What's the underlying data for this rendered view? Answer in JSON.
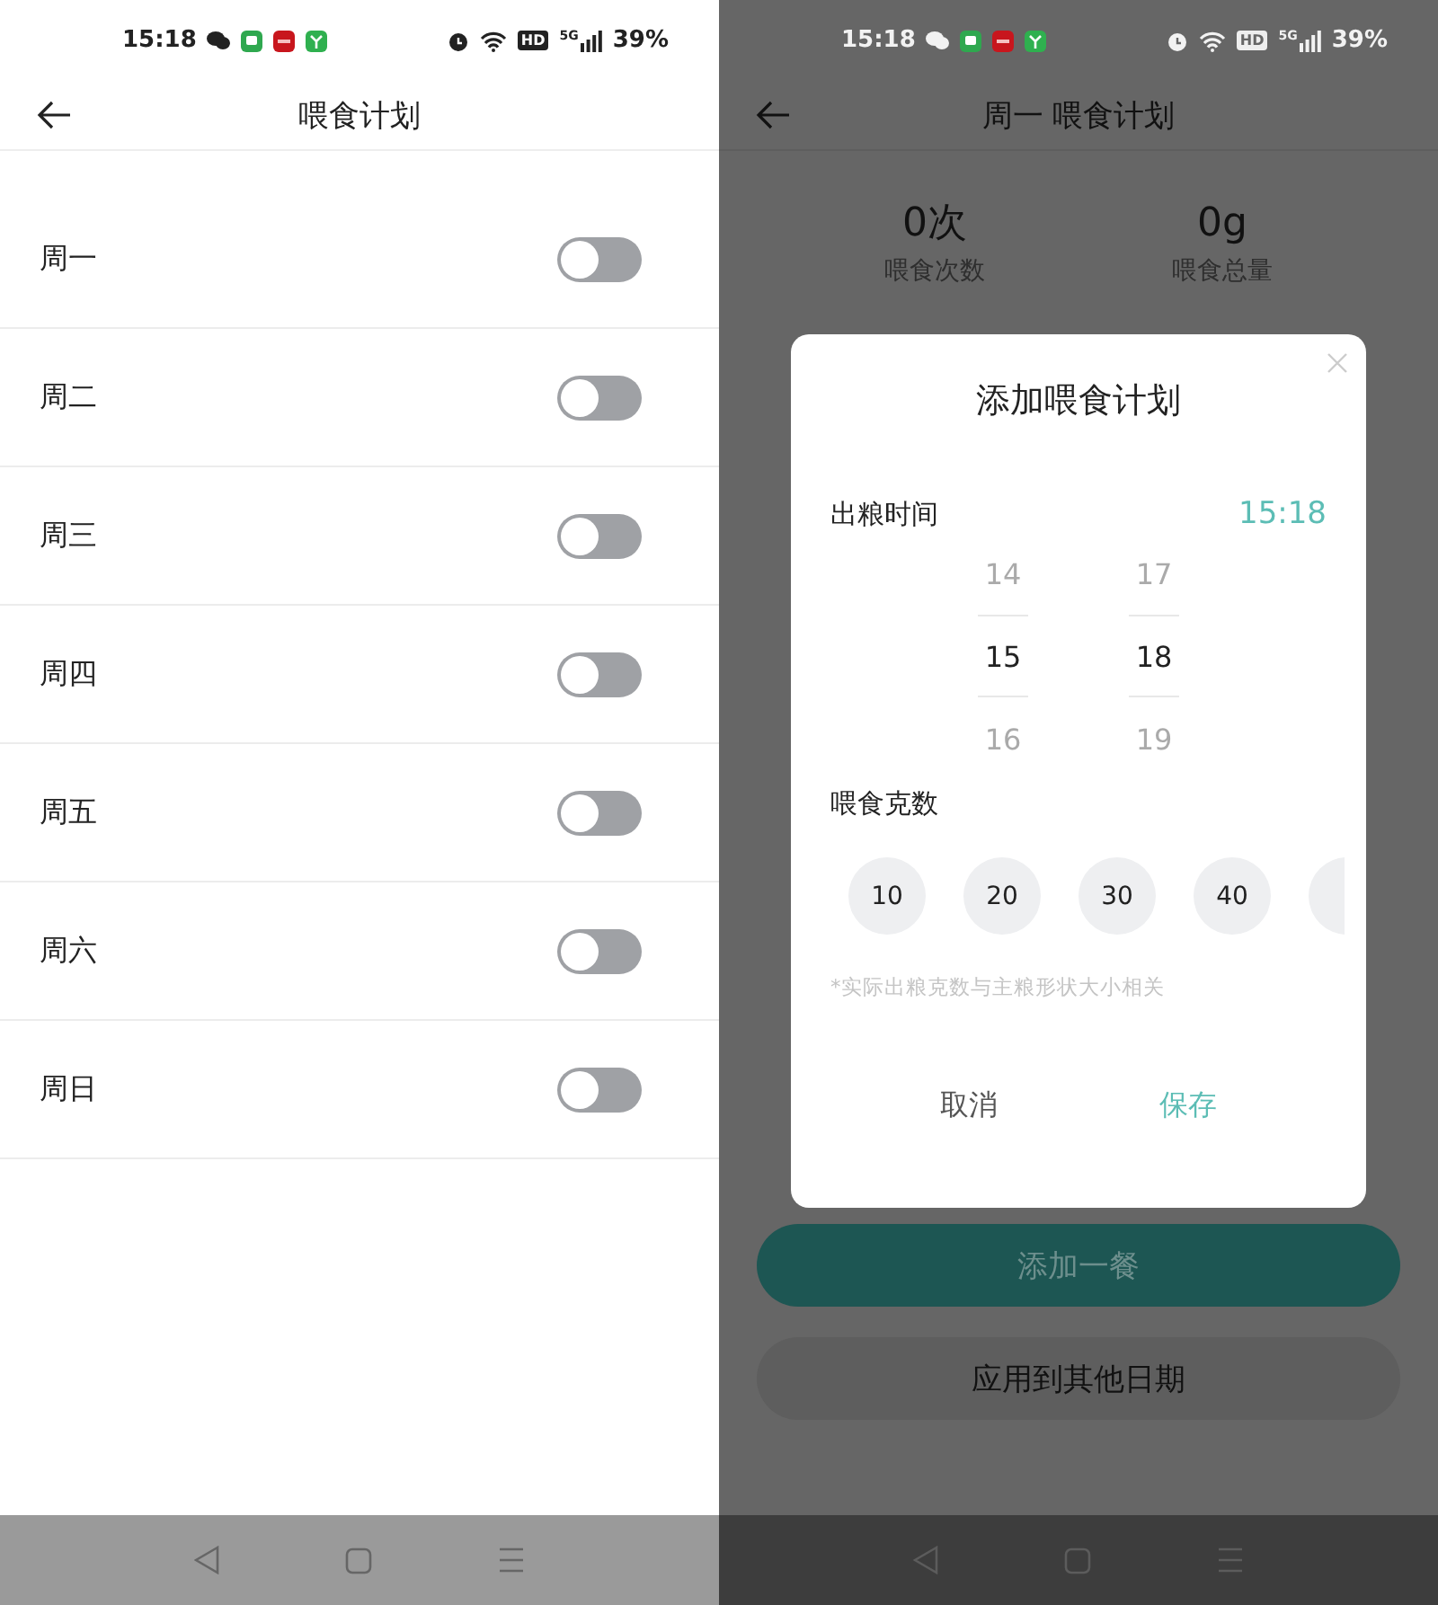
{
  "left_screen": {
    "status_bar": {
      "time": "15:18",
      "hd": "HD",
      "network": "5G",
      "battery": "39%"
    },
    "header": {
      "title": "喂食计划"
    },
    "days": [
      {
        "label": "周一",
        "on": false
      },
      {
        "label": "周二",
        "on": false
      },
      {
        "label": "周三",
        "on": false
      },
      {
        "label": "周四",
        "on": false
      },
      {
        "label": "周五",
        "on": false
      },
      {
        "label": "周六",
        "on": false
      },
      {
        "label": "周日",
        "on": false
      }
    ]
  },
  "right_screen": {
    "status_bar": {
      "time": "15:18",
      "hd": "HD",
      "network": "5G",
      "battery": "39%"
    },
    "header": {
      "title": "周一 喂食计划"
    },
    "stats": [
      {
        "value": "0次",
        "label": "喂食次数"
      },
      {
        "value": "0g",
        "label": "喂食总量"
      }
    ],
    "buttons": [
      {
        "label": "添加一餐",
        "kind": "primary"
      },
      {
        "label": "应用到其他日期",
        "kind": "secondary"
      }
    ],
    "dialog": {
      "title": "添加喂食计划",
      "time_label": "出粮时间",
      "time_value": "15:18",
      "hour_wheel": [
        {
          "value": "14",
          "selected": false
        },
        {
          "value": "15",
          "selected": true
        },
        {
          "value": "16",
          "selected": false
        }
      ],
      "minute_wheel": [
        {
          "value": "17",
          "selected": false
        },
        {
          "value": "18",
          "selected": true
        },
        {
          "value": "19",
          "selected": false
        }
      ],
      "amount_label": "喂食克数",
      "amounts": [
        {
          "label": "10"
        },
        {
          "label": "20"
        },
        {
          "label": "30"
        },
        {
          "label": "40"
        }
      ],
      "note": "*实际出粮克数与主粮形状大小相关",
      "cancel": "取消",
      "save": "保存"
    }
  }
}
